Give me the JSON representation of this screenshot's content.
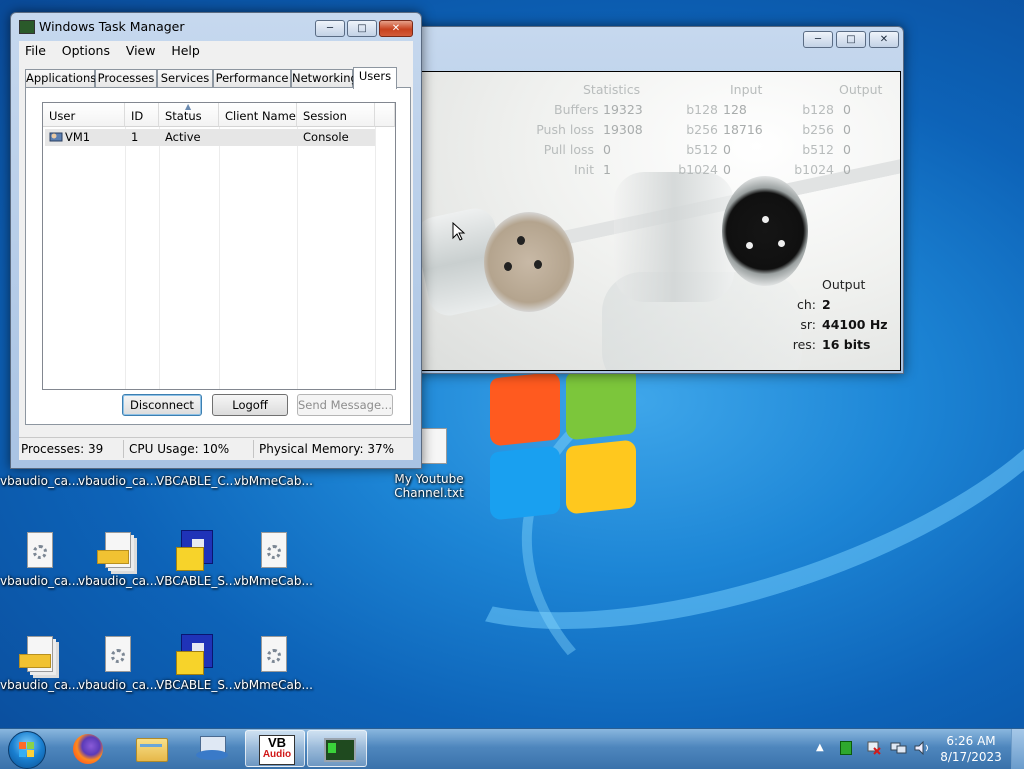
{
  "colors": {
    "desktop_blue": "#1d86d6",
    "taskbar": "#4e86bd",
    "close_red": "#c7421f"
  },
  "task_manager": {
    "title": "Windows Task Manager",
    "menu": [
      "File",
      "Options",
      "View",
      "Help"
    ],
    "tabs": [
      "Applications",
      "Processes",
      "Services",
      "Performance",
      "Networking",
      "Users"
    ],
    "active_tab": "Users",
    "columns": [
      "User",
      "ID",
      "Status",
      "Client Name",
      "Session"
    ],
    "sorted_column": "Status",
    "rows": [
      {
        "user": "VM1",
        "id": "1",
        "status": "Active",
        "client_name": "",
        "session": "Console"
      }
    ],
    "buttons": {
      "disconnect": "Disconnect",
      "logoff": "Logoff",
      "send_message": "Send Message..."
    },
    "status": {
      "processes": "Processes: 39",
      "cpu": "CPU Usage: 10%",
      "memory": "Physical Memory: 37%"
    }
  },
  "vbcable": {
    "headers": {
      "statistics": "Statistics",
      "input": "Input",
      "output": "Output"
    },
    "stats": [
      {
        "label": "Buffers",
        "value": "19323",
        "in_label": "b128",
        "in_value": "128",
        "out_label": "b128",
        "out_value": "0"
      },
      {
        "label": "Push loss",
        "value": "19308",
        "in_label": "b256",
        "in_value": "18716",
        "out_label": "b256",
        "out_value": "0"
      },
      {
        "label": "Pull loss",
        "value": "0",
        "in_label": "b512",
        "in_value": "0",
        "out_label": "b512",
        "out_value": "0"
      },
      {
        "label": "Init",
        "value": "1",
        "in_label": "b1024",
        "in_value": "0",
        "out_label": "b1024",
        "out_value": "0"
      }
    ],
    "output": {
      "heading": "Output",
      "ch_label": "ch:",
      "ch_value": "2",
      "sr_label": "sr:",
      "sr_value": "44100 Hz",
      "res_label": "res:",
      "res_value": "16 bits"
    }
  },
  "desktop": {
    "icons": [
      {
        "label": "vbaudio_ca...",
        "kind": "doc-gear"
      },
      {
        "label": "vbaudio_ca...",
        "kind": "doc-gear"
      },
      {
        "label": "VBCABLE_C...",
        "kind": "doc-gear"
      },
      {
        "label": "vbMmeCab...",
        "kind": "doc-gear"
      },
      {
        "label": "My Youtube Channel.txt",
        "kind": "text-file"
      },
      {
        "label": "vbaudio_ca...",
        "kind": "doc-gear"
      },
      {
        "label": "vbaudio_ca...",
        "kind": "stack-doc"
      },
      {
        "label": "VBCABLE_S...",
        "kind": "setup-floppy"
      },
      {
        "label": "vbMmeCab...",
        "kind": "doc-gear"
      },
      {
        "label": "vbaudio_ca...",
        "kind": "stack-doc"
      },
      {
        "label": "vbaudio_ca...",
        "kind": "doc-gear"
      },
      {
        "label": "VBCABLE_S...",
        "kind": "setup-floppy"
      },
      {
        "label": "vbMmeCab...",
        "kind": "doc-gear"
      }
    ]
  },
  "taskbar": {
    "vb_logo_top": "VB",
    "vb_logo_bottom": "Audio",
    "clock_time": "6:26 AM",
    "clock_date": "8/17/2023",
    "icons": [
      "start-orb-icon",
      "firefox-icon",
      "file-explorer-icon",
      "network-icon",
      "vb-audio-icon",
      "task-manager-icon"
    ]
  }
}
